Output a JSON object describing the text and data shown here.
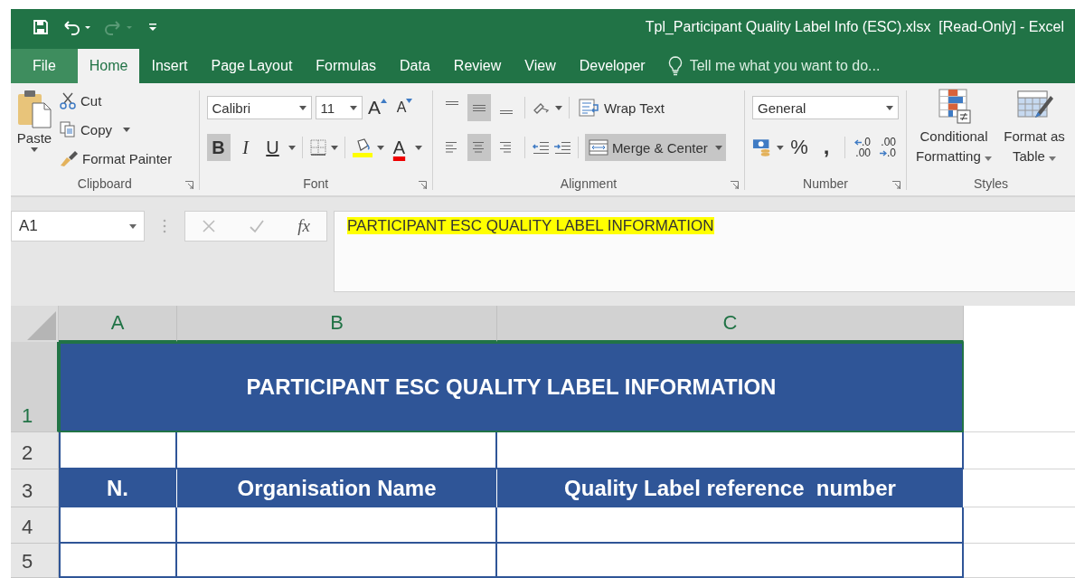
{
  "window": {
    "title": "Tpl_Participant Quality Label Info (ESC).xlsx  [Read-Only] - Excel"
  },
  "tabs": [
    {
      "label": "File",
      "kind": "file",
      "selected": false
    },
    {
      "label": "Home",
      "kind": "tab",
      "selected": true
    },
    {
      "label": "Insert",
      "kind": "tab",
      "selected": false
    },
    {
      "label": "Page Layout",
      "kind": "tab",
      "selected": false
    },
    {
      "label": "Formulas",
      "kind": "tab",
      "selected": false
    },
    {
      "label": "Data",
      "kind": "tab",
      "selected": false
    },
    {
      "label": "Review",
      "kind": "tab",
      "selected": false
    },
    {
      "label": "View",
      "kind": "tab",
      "selected": false
    },
    {
      "label": "Developer",
      "kind": "tab",
      "selected": false
    }
  ],
  "tell_me": {
    "placeholder": "Tell me what you want to do..."
  },
  "ribbon": {
    "clipboard": {
      "label": "Clipboard",
      "paste": "Paste",
      "cut": "Cut",
      "copy": "Copy",
      "format_painter": "Format Painter"
    },
    "font": {
      "label": "Font",
      "font_name": "Calibri",
      "font_size": "11",
      "grow": "A",
      "shrink": "A",
      "bold": {
        "text": "B",
        "pressed": true
      },
      "italic": {
        "text": "I",
        "pressed": false
      },
      "underline": {
        "text": "U",
        "pressed": false
      },
      "font_color": "A"
    },
    "alignment": {
      "label": "Alignment",
      "vertical_align": [
        {
          "selected": false
        },
        {
          "selected": true
        },
        {
          "selected": false
        }
      ],
      "horizontal_align": [
        {
          "selected": false
        },
        {
          "selected": true
        },
        {
          "selected": false
        }
      ],
      "wrap_text": "Wrap Text",
      "merge_center": {
        "text": "Merge & Center",
        "pressed": true
      }
    },
    "number": {
      "label": "Number",
      "format": "General",
      "percent": "%",
      "comma": ",",
      "increase_decimal": [
        ".0",
        ".00"
      ],
      "decrease_decimal": [
        ".00",
        ".0"
      ]
    },
    "styles": {
      "label": "Styles",
      "conditional": "Conditional Formatting",
      "format_as_table": "Format as Table"
    }
  },
  "formula_bar": {
    "name_box": "A1",
    "fx": "fx",
    "formula": "PARTICIPANT ESC QUALITY LABEL INFORMATION"
  },
  "sheet": {
    "columns": [
      {
        "label": "A",
        "selected": true
      },
      {
        "label": "B",
        "selected": true
      },
      {
        "label": "C",
        "selected": true
      }
    ],
    "rows": [
      {
        "label": "1",
        "kind": "title",
        "selected": true,
        "text": "PARTICIPANT ESC QUALITY LABEL INFORMATION"
      },
      {
        "label": "2",
        "kind": "blank",
        "selected": false
      },
      {
        "label": "3",
        "kind": "header",
        "selected": false,
        "cells": [
          "N.",
          "Organisation Name",
          "Quality Label reference  number"
        ]
      },
      {
        "label": "4",
        "kind": "blank",
        "selected": false
      },
      {
        "label": "5",
        "kind": "blank",
        "selected": false
      }
    ]
  }
}
